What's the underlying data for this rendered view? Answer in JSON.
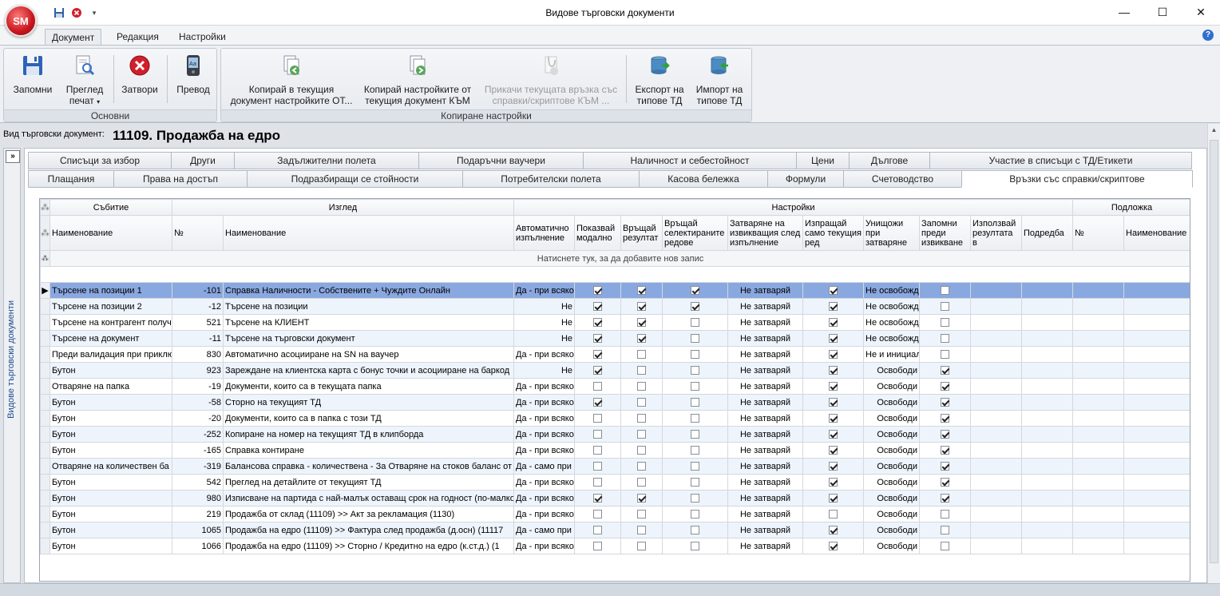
{
  "app": {
    "orb": "SM",
    "window_title": "Видове търговски документи",
    "colors": {
      "selection": "#8aa8e0",
      "alt_row": "#eef4fb",
      "link": "#1f4e91"
    }
  },
  "ribbon": {
    "tabs": [
      "Документ",
      "Редакция",
      "Настройки"
    ],
    "groups": {
      "basic": {
        "label": "Основни",
        "save": "Запомни",
        "preview_l1": "Преглед",
        "preview_l2": "печат",
        "close": "Затвори",
        "translate": "Превод"
      },
      "copy": {
        "label": "Копиране настройки",
        "copy_into_l1": "Копирай в текущия",
        "copy_into_l2": "документ настройките ОТ...",
        "copy_from_l1": "Копирай настройките от",
        "copy_from_l2": "текущия документ КЪМ",
        "attach_l1": "Прикачи текущата връзка със",
        "attach_l2": "справки/скриптове КЪМ ...",
        "export_l1": "Експорт на",
        "export_l2": "типове ТД",
        "import_l1": "Импорт на",
        "import_l2": "типове ТД"
      }
    }
  },
  "document": {
    "label": "Вид търговски документ:",
    "title": "11109. Продажба на едро"
  },
  "side_panel": {
    "expand": "»",
    "title": "Видове търговски документи"
  },
  "tabs_row1": [
    "Списъци за избор",
    "Други",
    "Задължителни полета",
    "Подаръчни ваучери",
    "Наличност и себестойност",
    "Цени",
    "Дългове",
    "Участие в списъци с ТД/Етикети"
  ],
  "tabs_row2": [
    "Плащания",
    "Права на достъп",
    "Подразбиращи се стойности",
    "Потребителски полета",
    "Касова бележка",
    "Формули",
    "Счетоводство",
    "Връзки със справки/скриптове"
  ],
  "grid": {
    "bands": {
      "event": "Събитие",
      "view": "Изглед",
      "settings": "Настройки",
      "base": "Подложка"
    },
    "columns": {
      "name": "Наименование",
      "num": "№",
      "vname": "Наименование",
      "auto": "Автоматично изпълнение",
      "modal": "Показвай модално",
      "result": "Връщай резултат",
      "selrows": "Връщай селектираните редове",
      "closing": "Затваряне на извикващия след изпълнение",
      "sendcur": "Изпращай само текущия ред",
      "destroy": "Унищожи при затваряне",
      "remember": "Запомни преди извикване",
      "useresult": "Използвай резултата в",
      "order": "Подредба",
      "bnum": "№",
      "bname": "Наименование"
    },
    "add_row": "Натиснете тук, за да добавите нов запис",
    "rows": [
      {
        "event": "Търсене на позиции 1",
        "num": "-101",
        "view": "Справка Наличности - Собствените + Чуждите Онлайн",
        "auto": "Да - при всяко",
        "modal": true,
        "result": true,
        "selrows": true,
        "closing": "Не затваряй",
        "sendcur": true,
        "destroy": "Не освобожд",
        "remember": false
      },
      {
        "event": "Търсене на позиции 2",
        "num": "-12",
        "view": "Търсене на позиции",
        "auto": "Не",
        "modal": true,
        "result": true,
        "selrows": true,
        "closing": "Не затваряй",
        "sendcur": true,
        "destroy": "Не освобожд",
        "remember": false
      },
      {
        "event": "Търсене на контрагент получ",
        "num": "521",
        "view": "Търсене на КЛИЕНТ",
        "auto": "Не",
        "modal": true,
        "result": true,
        "selrows": false,
        "closing": "Не затваряй",
        "sendcur": true,
        "destroy": "Не освобожд",
        "remember": false
      },
      {
        "event": "Търсене на документ",
        "num": "-11",
        "view": "Търсене на търговски документ",
        "auto": "Не",
        "modal": true,
        "result": true,
        "selrows": false,
        "closing": "Не затваряй",
        "sendcur": true,
        "destroy": "Не освобожд",
        "remember": false
      },
      {
        "event": "Преди валидация при приклю",
        "num": "830",
        "view": "Автоматично асоцииране на SN на ваучер",
        "auto": "Да - при всяко",
        "modal": true,
        "result": false,
        "selrows": false,
        "closing": "Не затваряй",
        "sendcur": true,
        "destroy": "Не и инициал",
        "remember": false
      },
      {
        "event": "Бутон",
        "num": "923",
        "view": "Зареждане на клиентска карта с бонус точки и асоцииране на баркод",
        "auto": "Не",
        "modal": true,
        "result": false,
        "selrows": false,
        "closing": "Не затваряй",
        "sendcur": true,
        "destroy": "Освободи",
        "remember": true
      },
      {
        "event": "Отваряне на папка",
        "num": "-19",
        "view": "Документи, които са в текущата папка",
        "auto": "Да - при всяко",
        "modal": false,
        "result": false,
        "selrows": false,
        "closing": "Не затваряй",
        "sendcur": true,
        "destroy": "Освободи",
        "remember": true
      },
      {
        "event": "Бутон",
        "num": "-58",
        "view": "Сторно на текущият ТД",
        "auto": "Да - при всяко",
        "modal": true,
        "result": false,
        "selrows": false,
        "closing": "Не затваряй",
        "sendcur": true,
        "destroy": "Освободи",
        "remember": true
      },
      {
        "event": "Бутон",
        "num": "-20",
        "view": "Документи, които са в папка с този ТД",
        "auto": "Да - при всяко",
        "modal": false,
        "result": false,
        "selrows": false,
        "closing": "Не затваряй",
        "sendcur": true,
        "destroy": "Освободи",
        "remember": true
      },
      {
        "event": "Бутон",
        "num": "-252",
        "view": "Копиране на номер на текущият ТД в клипборда",
        "auto": "Да - при всяко",
        "modal": false,
        "result": false,
        "selrows": false,
        "closing": "Не затваряй",
        "sendcur": true,
        "destroy": "Освободи",
        "remember": true
      },
      {
        "event": "Бутон",
        "num": "-165",
        "view": "Справка контиране",
        "auto": "Да - при всяко",
        "modal": false,
        "result": false,
        "selrows": false,
        "closing": "Не затваряй",
        "sendcur": true,
        "destroy": "Освободи",
        "remember": true
      },
      {
        "event": "Отваряне на количествен ба",
        "num": "-319",
        "view": "Балансова справка - количествена - За Отваряне на стоков баланс от",
        "auto": "Да - само при",
        "modal": false,
        "result": false,
        "selrows": false,
        "closing": "Не затваряй",
        "sendcur": true,
        "destroy": "Освободи",
        "remember": true
      },
      {
        "event": "Бутон",
        "num": "542",
        "view": "Преглед на детайлите от текущият ТД",
        "auto": "Да - при всяко",
        "modal": false,
        "result": false,
        "selrows": false,
        "closing": "Не затваряй",
        "sendcur": true,
        "destroy": "Освободи",
        "remember": true
      },
      {
        "event": "Бутон",
        "num": "980",
        "view": "Изписване на партида с най-малък оставащ срок на годност (по-малко",
        "auto": "Да - при всяко",
        "modal": true,
        "result": true,
        "selrows": false,
        "closing": "Не затваряй",
        "sendcur": true,
        "destroy": "Освободи",
        "remember": true
      },
      {
        "event": "Бутон",
        "num": "219",
        "view": "Продажба от склад (11109) >> Акт за рекламация (1130)",
        "auto": "Да - при всяко",
        "modal": false,
        "result": false,
        "selrows": false,
        "closing": "Не затваряй",
        "sendcur": false,
        "destroy": "Освободи",
        "remember": false
      },
      {
        "event": "Бутон",
        "num": "1065",
        "view": "Продажба на едро (11109) >> Фактура след продажба (д.осн) (11117",
        "auto": "Да - само при",
        "modal": false,
        "result": false,
        "selrows": false,
        "closing": "Не затваряй",
        "sendcur": true,
        "destroy": "Освободи",
        "remember": false
      },
      {
        "event": "Бутон",
        "num": "1066",
        "view": "Продажба на едро (11109) >> Сторно / Кредитно на едро (к.ст.д.) (1",
        "auto": "Да - при всяко",
        "modal": false,
        "result": false,
        "selrows": false,
        "closing": "Не затваряй",
        "sendcur": true,
        "destroy": "Освободи",
        "remember": false
      }
    ]
  }
}
